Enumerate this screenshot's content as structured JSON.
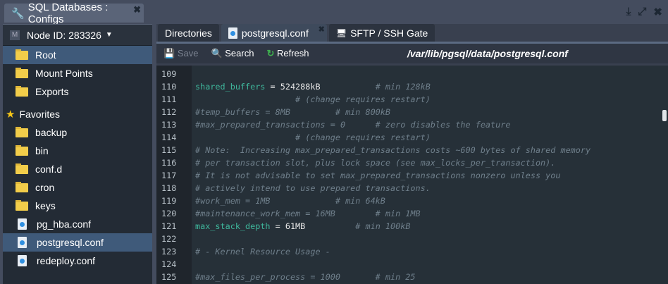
{
  "window": {
    "title": "SQL Databases : Configs",
    "icons": [
      "wrench-icon",
      "download-icon",
      "expand-icon",
      "close-icon"
    ]
  },
  "sidebar": {
    "node_label": "Node ID: 283326",
    "top_items": [
      {
        "label": "Root",
        "icon": "folder"
      },
      {
        "label": "Mount Points",
        "icon": "folder"
      },
      {
        "label": "Exports",
        "icon": "link"
      }
    ],
    "favorites_label": "Favorites",
    "favorites": [
      {
        "label": "backup",
        "icon": "folder"
      },
      {
        "label": "bin",
        "icon": "folder"
      },
      {
        "label": "conf.d",
        "icon": "folder"
      },
      {
        "label": "cron",
        "icon": "folder"
      },
      {
        "label": "keys",
        "icon": "folder"
      },
      {
        "label": "pg_hba.conf",
        "icon": "file"
      },
      {
        "label": "postgresql.conf",
        "icon": "file"
      },
      {
        "label": "redeploy.conf",
        "icon": "file"
      }
    ]
  },
  "tabs": [
    "Directories",
    "postgresql.conf",
    "SFTP / SSH Gate"
  ],
  "toolbar": {
    "save": "Save",
    "search": "Search",
    "refresh": "Refresh",
    "path": "/var/lib/pgsql/data/postgresql.conf"
  },
  "editor": {
    "lines": [
      {
        "n": "109",
        "k": "",
        "v": "",
        "c": ""
      },
      {
        "n": "110",
        "k": "shared_buffers",
        "v": " = 524288kB           ",
        "c": "# min 128kB"
      },
      {
        "n": "111",
        "k": "",
        "v": "",
        "c": "                    # (change requires restart)"
      },
      {
        "n": "112",
        "k": "",
        "v": "",
        "c": "#temp_buffers = 8MB         # min 800kB"
      },
      {
        "n": "113",
        "k": "",
        "v": "",
        "c": "#max_prepared_transactions = 0      # zero disables the feature"
      },
      {
        "n": "114",
        "k": "",
        "v": "",
        "c": "                    # (change requires restart)"
      },
      {
        "n": "115",
        "k": "",
        "v": "",
        "c": "# Note:  Increasing max_prepared_transactions costs ~600 bytes of shared memory"
      },
      {
        "n": "116",
        "k": "",
        "v": "",
        "c": "# per transaction slot, plus lock space (see max_locks_per_transaction)."
      },
      {
        "n": "117",
        "k": "",
        "v": "",
        "c": "# It is not advisable to set max_prepared_transactions nonzero unless you"
      },
      {
        "n": "118",
        "k": "",
        "v": "",
        "c": "# actively intend to use prepared transactions."
      },
      {
        "n": "119",
        "k": "",
        "v": "",
        "c": "#work_mem = 1MB             # min 64kB"
      },
      {
        "n": "120",
        "k": "",
        "v": "",
        "c": "#maintenance_work_mem = 16MB        # min 1MB"
      },
      {
        "n": "121",
        "k": "max_stack_depth",
        "v": " = 61MB          ",
        "c": "# min 100kB"
      },
      {
        "n": "122",
        "k": "",
        "v": "",
        "c": ""
      },
      {
        "n": "123",
        "k": "",
        "v": "",
        "c": "# - Kernel Resource Usage -"
      },
      {
        "n": "124",
        "k": "",
        "v": "",
        "c": ""
      },
      {
        "n": "125",
        "k": "",
        "v": "",
        "c": "#max_files_per_process = 1000       # min 25"
      }
    ]
  }
}
